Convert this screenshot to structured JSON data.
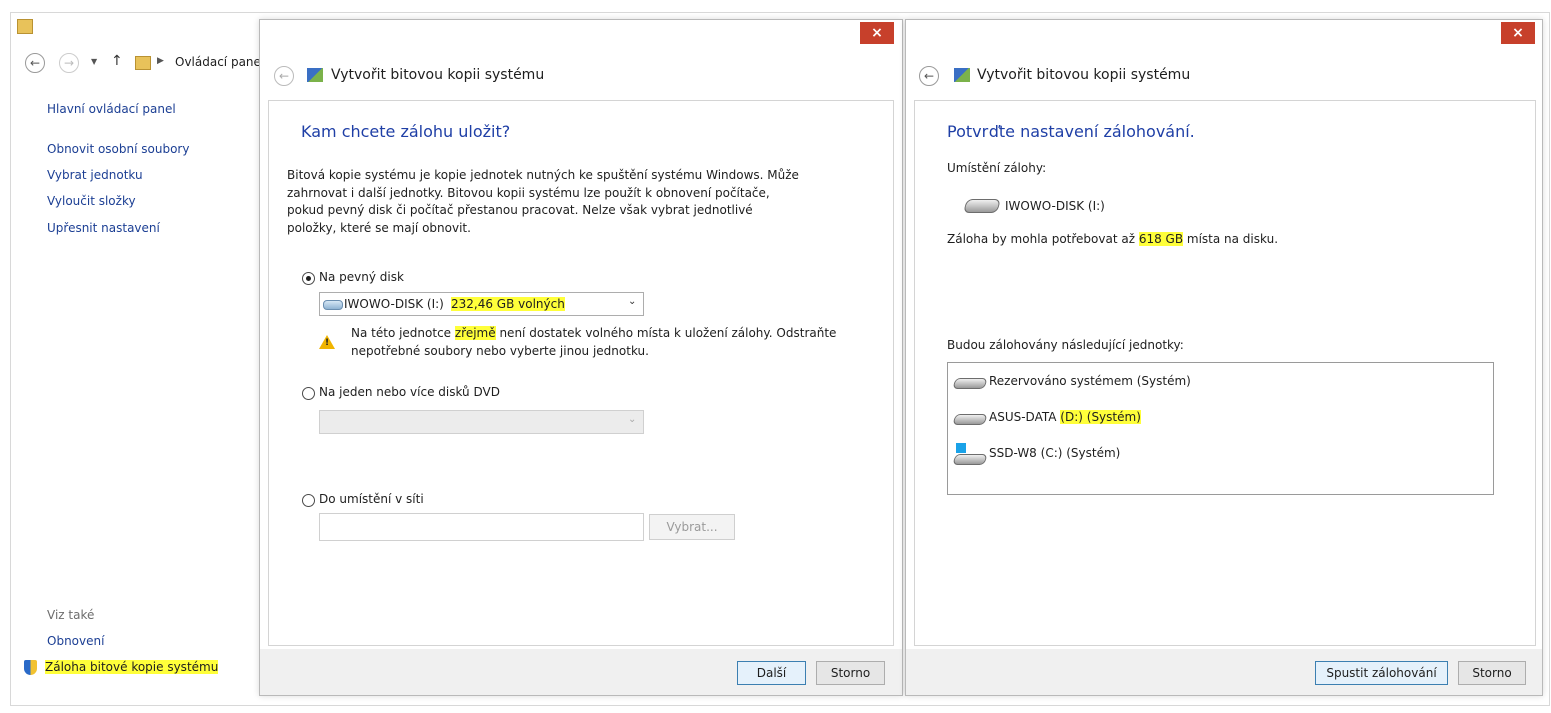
{
  "control_panel": {
    "address_text": "Ovládací pane",
    "links": [
      "Hlavní ovládací panel",
      "Obnovit osobní soubory",
      "Vybrat jednotku",
      "Vyloučit složky",
      "Upřesnit nastavení"
    ],
    "see_also": "Viz také",
    "recovery": "Obnovení",
    "system_image_backup": "Záloha bitové kopie systému"
  },
  "dialog1": {
    "title": "Vytvořit bitovou kopii systému",
    "close": "×",
    "heading": "Kam chcete zálohu uložit?",
    "description": "Bitová kopie systému je kopie jednotek nutných ke spuštění systému Windows. Může zahrnovat i další jednotky. Bitovou kopii systému lze použít k obnovení počítače, pokud pevný disk či počítač přestanou pracovat. Nelze však vybrat jednotlivé položky, které se mají obnovit.",
    "option_hdd": "Na pevný disk",
    "hdd_select_name": "IWOWO-DISK (I:)",
    "hdd_select_free": "232,46 GB volných",
    "warning_pre": "Na této jednotce ",
    "warning_highlight": "zřejmě",
    "warning_post": " není dostatek volného místa k uložení zálohy. Odstraňte nepotřebné soubory nebo vyberte jinou jednotku.",
    "option_dvd": "Na jeden nebo více disků DVD",
    "option_network": "Do umístění v síti",
    "browse_button": "Vybrat...",
    "next_button": "Další",
    "cancel_button": "Storno"
  },
  "dialog2": {
    "title": "Vytvořit bitovou kopii systému",
    "close": "×",
    "heading": "Potvrďte nastavení zálohování.",
    "location_label": "Umístění zálohy:",
    "location_drive": "IWOWO-DISK (I:)",
    "need_pre": "Záloha by mohla potřebovat až ",
    "need_value": "618 GB",
    "need_post": " místa na disku.",
    "drives_label": "Budou zálohovány následující jednotky:",
    "drives": [
      {
        "name": "Rezervováno systémem (Systém)",
        "highlight": ""
      },
      {
        "name": "ASUS-DATA ",
        "highlight": "(D:) (Systém)"
      },
      {
        "name": "SSD-W8 (C:) (Systém)",
        "highlight": ""
      }
    ],
    "start_button": "Spustit zálohování",
    "cancel_button": "Storno"
  },
  "colors": {
    "heading": "#1f3fa6",
    "link": "#1c3f94",
    "highlight": "#ffff3a",
    "close": "#c7402b"
  }
}
